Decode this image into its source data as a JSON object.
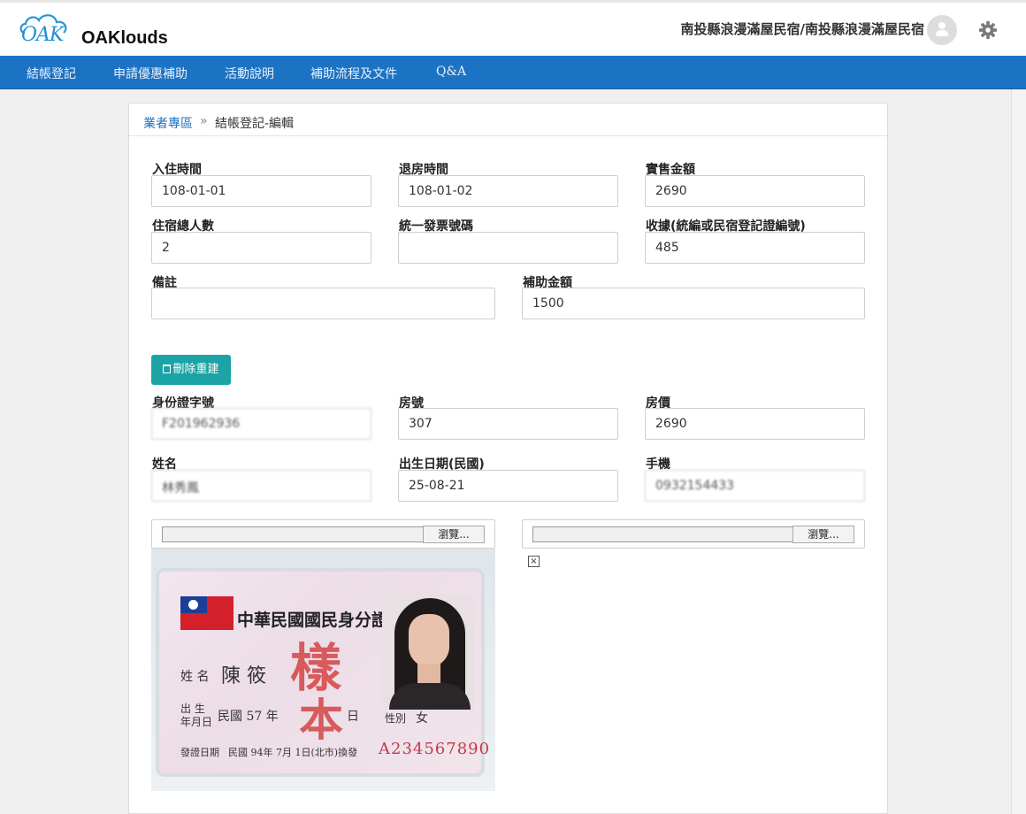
{
  "header": {
    "logo_mark": "OAK",
    "logo_text": "OAKlouds",
    "user_name": "南投縣浪漫滿屋民宿/南投縣浪漫滿屋民宿"
  },
  "nav": {
    "items": [
      {
        "label": "結帳登記"
      },
      {
        "label": "申請優惠補助"
      },
      {
        "label": "活動說明"
      },
      {
        "label": "補助流程及文件"
      },
      {
        "label": "Q&A"
      }
    ]
  },
  "breadcrumb": {
    "parent": "業者專區",
    "separator": "»",
    "current": "結帳登記-編輯"
  },
  "form": {
    "checkin": {
      "label": "入住時間",
      "value": "108-01-01"
    },
    "checkout": {
      "label": "退房時間",
      "value": "108-01-02"
    },
    "sale_amount": {
      "label": "實售金額",
      "value": "2690"
    },
    "guests": {
      "label": "住宿總人數",
      "value": "2"
    },
    "invoice": {
      "label": "統一發票號碼",
      "value": ""
    },
    "receipt": {
      "label": "收據(統編或民宿登記證編號)",
      "value": "485"
    },
    "remark": {
      "label": "備註",
      "value": ""
    },
    "subsidy": {
      "label": "補助金額",
      "value": "1500"
    },
    "delete_button": "刪除重建",
    "id_no": {
      "label": "身份證字號",
      "value": "F201962936"
    },
    "room_no": {
      "label": "房號",
      "value": "307"
    },
    "room_price": {
      "label": "房價",
      "value": "2690"
    },
    "name": {
      "label": "姓名",
      "value": "林秀鳳"
    },
    "birthday": {
      "label": "出生日期(民國)",
      "value": "25-08-21"
    },
    "mobile": {
      "label": "手機",
      "value": "0932154433"
    },
    "browse_label": "瀏覽..."
  },
  "id_card": {
    "title": "中華民國國民身分證",
    "name_label": "姓 名",
    "name": "陳 筱",
    "birth_label_1": "出 生",
    "birth_label_2": "年月日",
    "birth": "民國 57 年",
    "birth_day_suffix": "日",
    "sex_label": "性別",
    "sex": "女",
    "issue_label": "發證日期",
    "issue": "民國 94年 7月 1日(北市)換發",
    "number": "A234567890",
    "stamp_1": "樣",
    "stamp_2": "本"
  }
}
